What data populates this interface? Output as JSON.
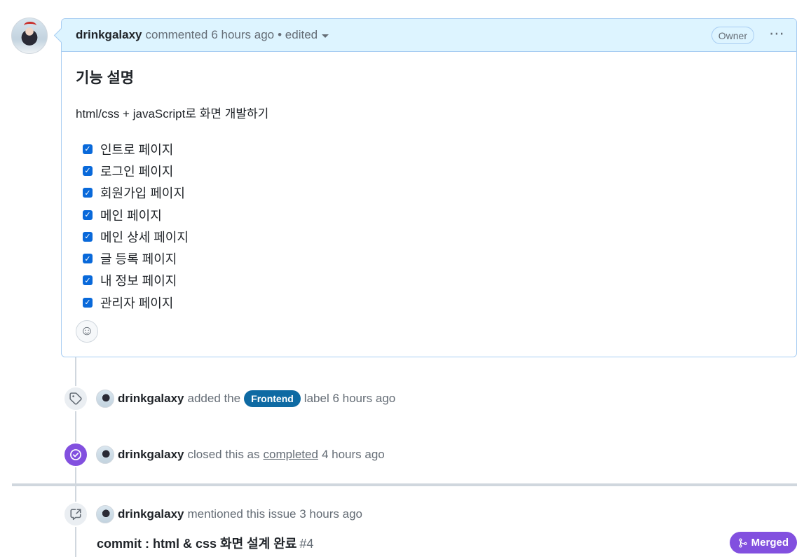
{
  "comment": {
    "author": "drinkgalaxy",
    "action": "commented",
    "time": "6 hours ago",
    "edited": "• edited",
    "role_badge": "Owner",
    "menu_icon": "kebab-horizontal-icon",
    "title": "기능 설명",
    "description": "html/css + javaScript로 화면 개발하기",
    "tasks": [
      {
        "label": "인트로 페이지",
        "checked": true
      },
      {
        "label": "로그인 페이지",
        "checked": true
      },
      {
        "label": "회원가입 페이지",
        "checked": true
      },
      {
        "label": "메인 페이지",
        "checked": true
      },
      {
        "label": "메인 상세 페이지",
        "checked": true
      },
      {
        "label": "글 등록 페이지",
        "checked": true
      },
      {
        "label": "내 정보 페이지",
        "checked": true
      },
      {
        "label": "관리자 페이지",
        "checked": true
      }
    ],
    "reaction_icon": "smiley-icon"
  },
  "events": {
    "label_event": {
      "author": "drinkgalaxy",
      "prefix": "added the",
      "label": "Frontend",
      "suffix": "label 6 hours ago",
      "label_color": "#0e6aa3",
      "icon": "tag-icon"
    },
    "closed_event": {
      "author": "drinkgalaxy",
      "prefix": "closed this as",
      "link": "completed",
      "suffix": "4 hours ago",
      "icon": "check-circle-icon",
      "icon_color": "#8250df"
    },
    "mention_event": {
      "author": "drinkgalaxy",
      "text": "mentioned this issue 3 hours ago",
      "icon": "cross-reference-icon",
      "commit_title": "commit : html & css 화면 설계 완료",
      "commit_number": "#4",
      "status_badge": "Merged",
      "status_color": "#8250df"
    }
  }
}
